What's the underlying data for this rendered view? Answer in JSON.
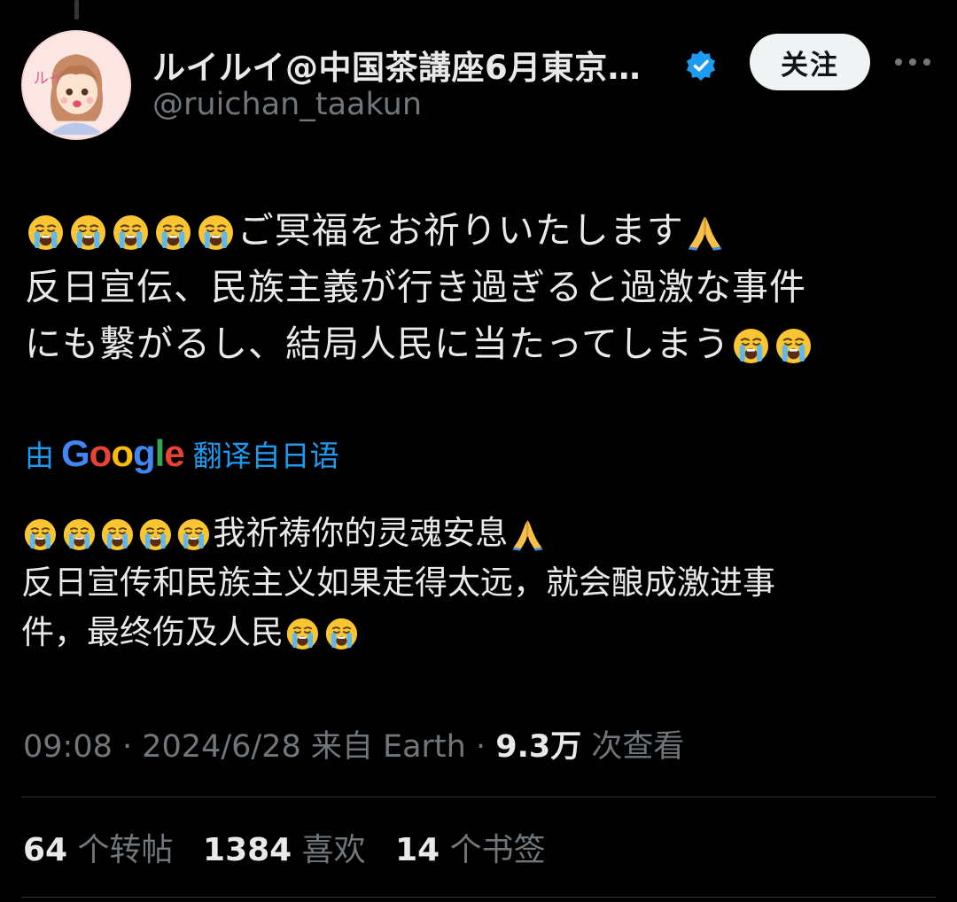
{
  "author": {
    "display_name": "ルイルイ@中国茶講座6月東京…",
    "handle": "@ruichan_taakun",
    "avatar_label": "ルイ"
  },
  "follow_label": "关注",
  "original": {
    "line1": "ご冥福をお祈りいたします",
    "line2": "反日宣伝、民族主義が行き過ぎると過激な事件",
    "line3": "にも繫がるし、結局人民に当たってしまう"
  },
  "translation_note": {
    "prefix": "由",
    "provider": "Google",
    "suffix": "翻译自日语"
  },
  "translated": {
    "line1": "我祈祷你的灵魂安息",
    "line2": "反日宣传和民族主义如果走得太远，就会酿成激进事",
    "line3": "件，最终伤及人民"
  },
  "meta": {
    "time": "09:08",
    "sep1": " · ",
    "date": "2024/6/28",
    "source": " 来自 Earth",
    "sep2": " · ",
    "views": "9.3万",
    "views_label": " 次查看"
  },
  "stats": {
    "reposts": "64",
    "reposts_label": " 个转帖",
    "likes": "1384",
    "likes_label": " 喜欢",
    "bookmarks": "14",
    "bookmarks_label": " 个书签"
  },
  "colors": {
    "accent": "#1d9bf0",
    "muted": "#71767b",
    "text": "#e7e9ea",
    "background": "#000000"
  },
  "icons": [
    "crying-face-emoji",
    "folded-hands-emoji",
    "verified-badge-icon",
    "more-icon"
  ]
}
